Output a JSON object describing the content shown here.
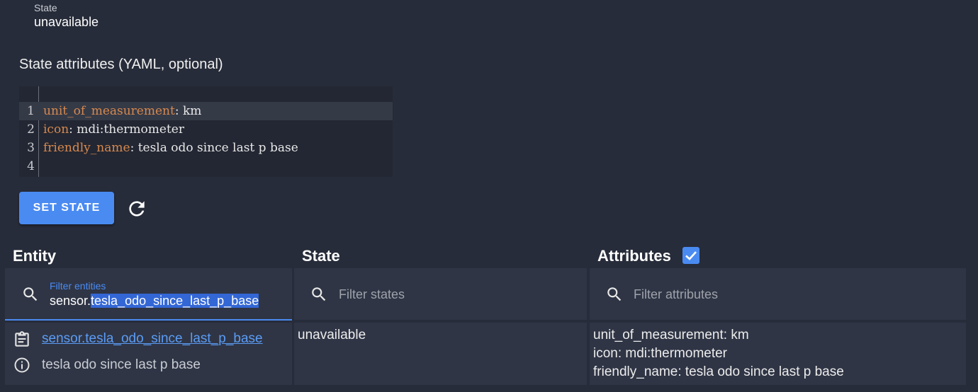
{
  "state": {
    "label": "State",
    "value": "unavailable"
  },
  "attributes_editor": {
    "heading": "State attributes (YAML, optional)",
    "lines": [
      {
        "number": "1",
        "key": "unit_of_measurement",
        "value": ": km"
      },
      {
        "number": "2",
        "key": "icon",
        "value": ": mdi:thermometer"
      },
      {
        "number": "3",
        "key": "friendly_name",
        "value": ": tesla odo since last p base"
      },
      {
        "number": "4",
        "key": "",
        "value": ""
      }
    ]
  },
  "actions": {
    "set_state_label": "SET STATE",
    "refresh_icon": "refresh-icon"
  },
  "table": {
    "headers": {
      "entity": "Entity",
      "state": "State",
      "attributes": "Attributes"
    },
    "attributes_checkbox_checked": true,
    "filters": {
      "entity": {
        "label": "Filter entities",
        "value_prefix": "sensor.",
        "value_selected": "tesla_odo_since_last_p_base"
      },
      "state": {
        "placeholder": "Filter states"
      },
      "attributes": {
        "placeholder": "Filter attributes"
      }
    },
    "rows": [
      {
        "entity_id": "sensor.tesla_odo_since_last_p_base",
        "friendly_name": "tesla odo since last p base",
        "state": "unavailable",
        "attributes": [
          "unit_of_measurement: km",
          "icon: mdi:thermometer",
          "friendly_name: tesla odo since last p base"
        ]
      }
    ]
  },
  "colors": {
    "accent": "#4a8bf2",
    "background": "#272c3a",
    "panel": "#2f3545",
    "yaml_key": "#d7894e"
  }
}
